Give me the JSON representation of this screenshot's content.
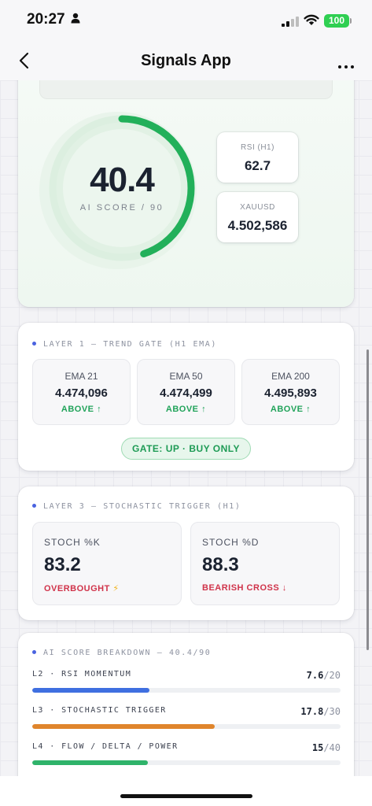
{
  "status_bar": {
    "time": "20:27",
    "battery": "100"
  },
  "nav": {
    "title": "Signals App"
  },
  "score": {
    "value": "40.4",
    "label": "AI SCORE / 90",
    "gauge_fraction": 0.449,
    "rsi_label": "RSI (H1)",
    "rsi_value": "62.7",
    "symbol_label": "XAUUSD",
    "symbol_value": "4.502,586"
  },
  "trend_gate": {
    "header": "LAYER 1 — TREND GATE (H1 EMA)",
    "emas": [
      {
        "label": "EMA 21",
        "value": "4.474,096",
        "state": "ABOVE ↑"
      },
      {
        "label": "EMA 50",
        "value": "4.474,499",
        "state": "ABOVE ↑"
      },
      {
        "label": "EMA 200",
        "value": "4.495,893",
        "state": "ABOVE ↑"
      }
    ],
    "gate": "GATE: UP · BUY ONLY"
  },
  "stochastic": {
    "header": "LAYER 3 — STOCHASTIC TRIGGER (H1)",
    "k": {
      "label": "STOCH %K",
      "value": "83.2",
      "state": "OVERBOUGHT",
      "state_icon": "⚡"
    },
    "d": {
      "label": "STOCH %D",
      "value": "88.3",
      "state": "BEARISH CROSS ↓"
    }
  },
  "breakdown": {
    "header": "AI SCORE BREAKDOWN — 40.4/90",
    "rows": [
      {
        "name": "L2 · RSI MOMENTUM",
        "score": "7.6",
        "max": "/20",
        "fraction": 0.38,
        "color": "#3f6fe0"
      },
      {
        "name": "L3 · STOCHASTIC TRIGGER",
        "score": "17.8",
        "max": "/30",
        "fraction": 0.593,
        "color": "#e0852c"
      },
      {
        "name": "L4 · FLOW / DELTA / POWER",
        "score": "15",
        "max": "/40",
        "fraction": 0.375,
        "color": "#2fb36a"
      }
    ]
  },
  "colors": {
    "accent_green": "#21a35a",
    "accent_red": "#d0334a",
    "accent_blue": "#4a63e0"
  }
}
